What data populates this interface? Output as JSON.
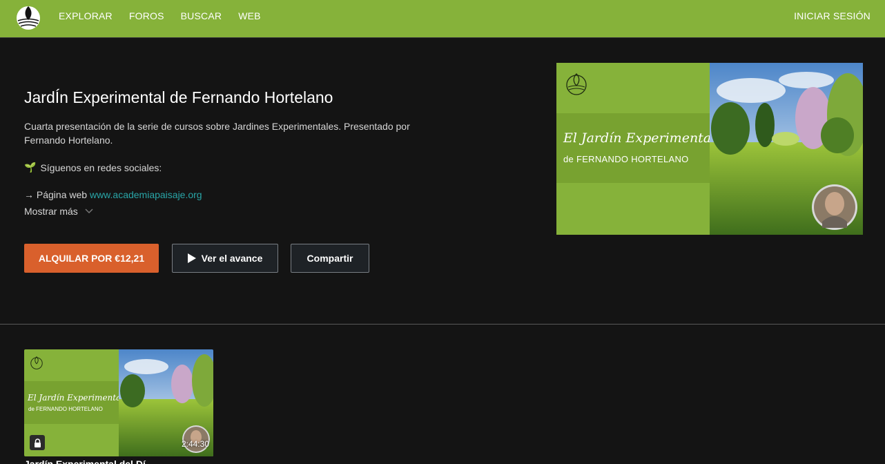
{
  "nav": {
    "items": [
      "EXPLORAR",
      "FOROS",
      "BUSCAR",
      "WEB"
    ],
    "login": "INICIAR SESIÓN"
  },
  "course": {
    "title": "JardÍn Experimental de Fernando Hortelano",
    "description": "Cuarta presentación de la serie de cursos sobre Jardines Experimentales. Presentado por Fernando Hortelano.",
    "social_emoji": "🌱",
    "social_label": "Síguenos en redes sociales:",
    "web_prefix": "→ Página web",
    "web_link": "www.academiapaisaje.org",
    "show_more": "Mostrar más"
  },
  "buttons": {
    "rent": "ALQUILAR POR €12,21",
    "trailer": "Ver el avance",
    "share": "Compartir"
  },
  "poster": {
    "title": "El Jardín Experimental",
    "subtitle": "de FERNANDO HORTELANO"
  },
  "episode": {
    "title": "El Jardín Experimental",
    "subtitle": "de FERNANDO HORTELANO",
    "duration": "2:44:30",
    "title_below": "Jardín Experimental del Dí..."
  },
  "colors": {
    "topbar": "#86b23a",
    "accent_orange": "#d9602c",
    "link_teal": "#29a6a8",
    "background": "#141414"
  }
}
